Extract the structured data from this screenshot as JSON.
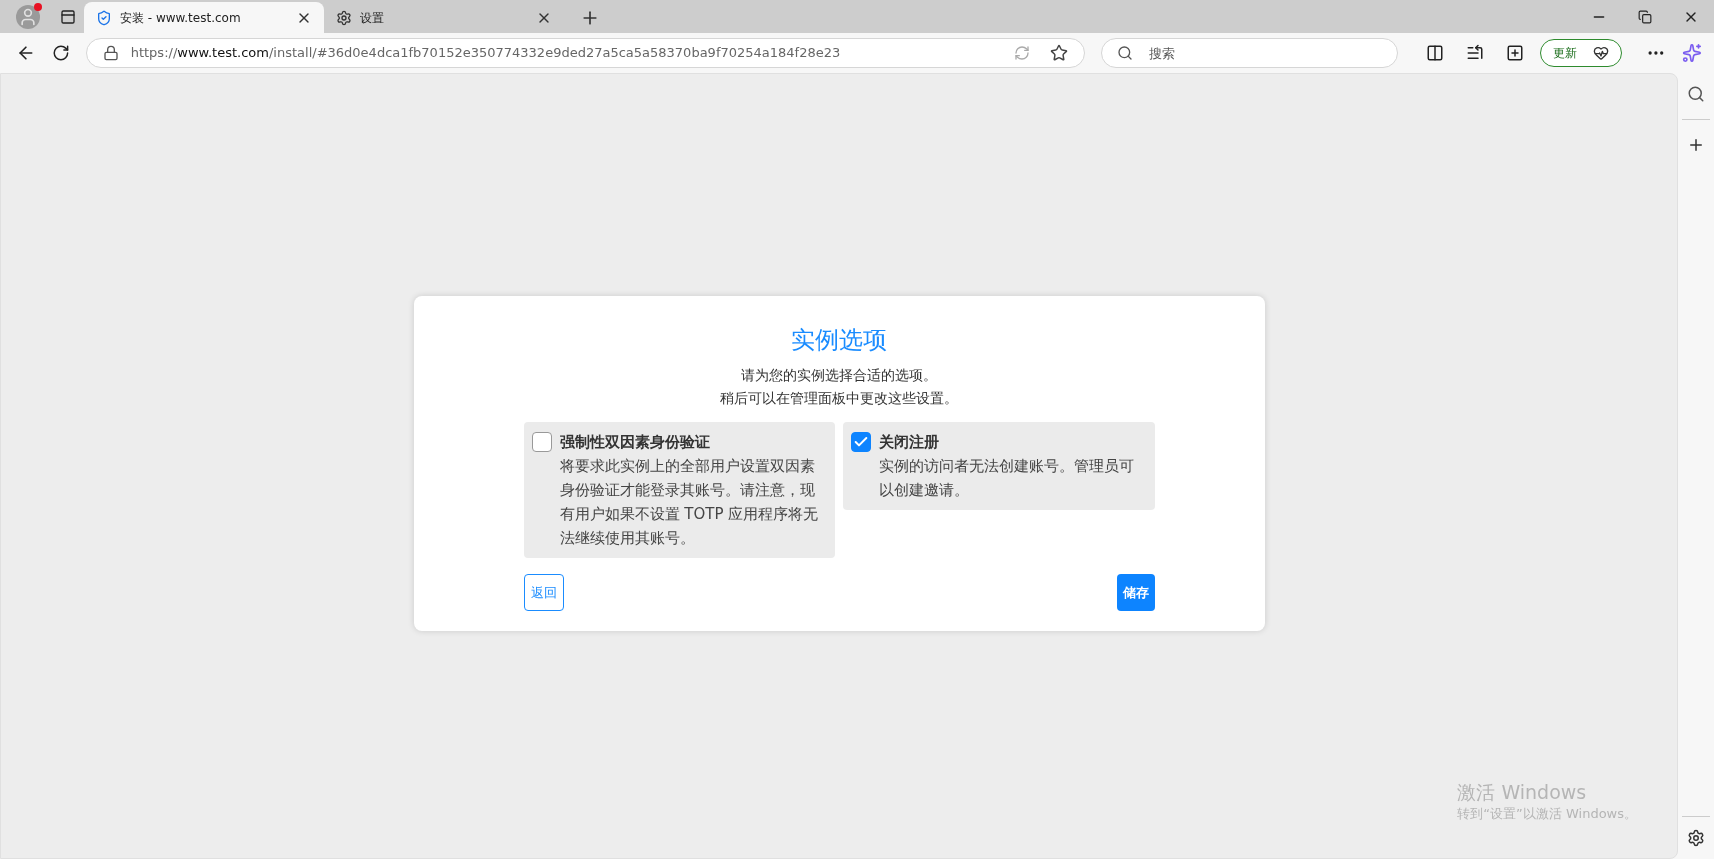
{
  "browser": {
    "tabs": [
      {
        "kind": "site",
        "title": "安装 - www.test.com",
        "selected": true
      },
      {
        "kind": "settings",
        "title": "设置",
        "selected": false
      }
    ],
    "address": {
      "scheme": "https://",
      "host": "www.test.com",
      "path": "/install/#36d0e4dca1fb70152e350774332e9ded27a5ca5a58370ba9f70254a184f28e23"
    },
    "search": {
      "placeholder": "搜索"
    },
    "update_button": "更新"
  },
  "dialog": {
    "title": "实例选项",
    "subtitle_lines": [
      "请为您的实例选择合适的选项。",
      "稍后可以在管理面板中更改这些设置。"
    ],
    "options": [
      {
        "title": "强制性双因素身份验证",
        "description": "将要求此实例上的全部用户设置双因素身份验证才能登录其账号。请注意，现有用户如果不设置 TOTP 应用程序将无法继续使用其账号。",
        "checked": false
      },
      {
        "title": "关闭注册",
        "description": "实例的访问者无法创建账号。管理员可以创建邀请。",
        "checked": true
      }
    ],
    "back_button": "返回",
    "save_button": "储存"
  },
  "activation_notice": {
    "title": "激活 Windows",
    "text": "转到“设置”以激活 Windows。"
  }
}
